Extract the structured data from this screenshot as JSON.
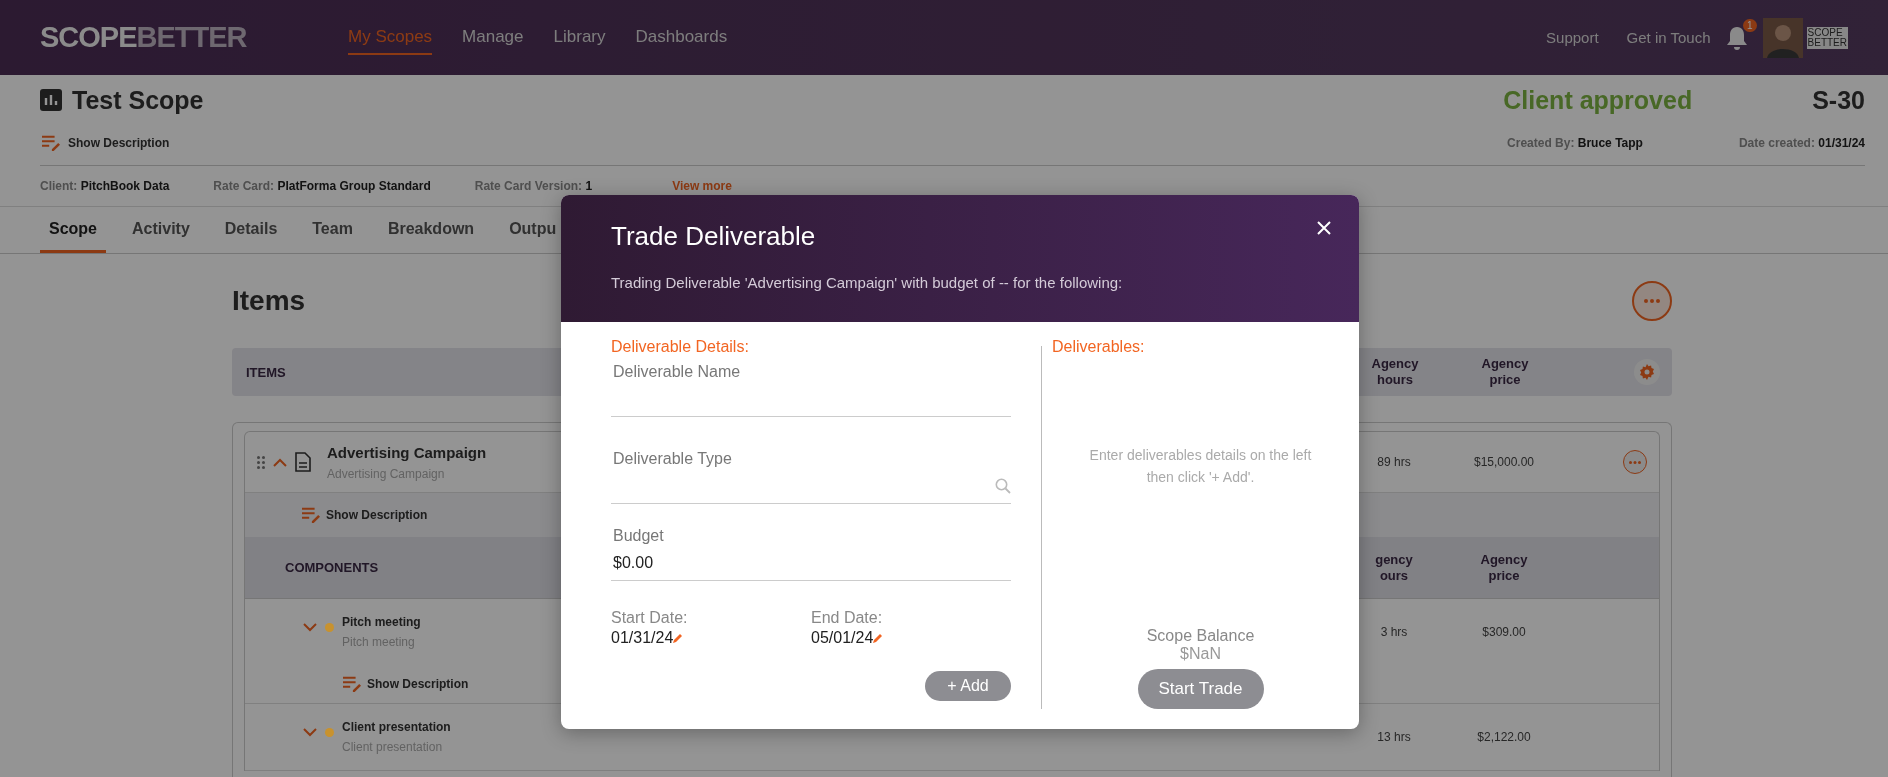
{
  "header": {
    "logo": [
      "SCOPE",
      "BETTER"
    ],
    "nav": [
      {
        "label": "My Scopes",
        "selected": true
      },
      {
        "label": "Manage",
        "selected": false
      },
      {
        "label": "Library",
        "selected": false
      },
      {
        "label": "Dashboards",
        "selected": false
      }
    ],
    "links": [
      "Support",
      "Get in Touch"
    ],
    "notification_count": "1",
    "company_logo": [
      "SCOPE",
      "BETTER"
    ]
  },
  "scope": {
    "title": "Test Scope",
    "show_description": "Show Description",
    "status": "Client approved",
    "id": "S-30",
    "created_by": {
      "label": "Created By:",
      "value": "Bruce Tapp"
    },
    "date_created": {
      "label": "Date created:",
      "value": "01/31/24"
    },
    "meta": [
      {
        "label": "Client:",
        "value": "PitchBook Data"
      },
      {
        "label": "Rate Card:",
        "value": "PlatForma Group Standard"
      },
      {
        "label": "Rate Card Version:",
        "value": "1"
      }
    ],
    "view_more": "View more"
  },
  "tabs": [
    {
      "label": "Scope",
      "selected": true
    },
    {
      "label": "Activity",
      "selected": false
    },
    {
      "label": "Details",
      "selected": false
    },
    {
      "label": "Team",
      "selected": false
    },
    {
      "label": "Breakdown",
      "selected": false
    },
    {
      "label": "Outpu",
      "selected": false
    }
  ],
  "items_section": {
    "title": "Items",
    "header": {
      "label": "ITEMS",
      "columns": [
        "Agency hours",
        "Agency price"
      ]
    },
    "items": [
      {
        "name": "Advertising Campaign",
        "subtitle": "Advertising Campaign",
        "expanded": true,
        "hours": "89 hrs",
        "price": "$15,000.00",
        "show_description": "Show Description",
        "components_header": {
          "label": "COMPONENTS",
          "columns": [
            "gency ours",
            "Agency price"
          ]
        },
        "components": [
          {
            "name": "Pitch meeting",
            "subtitle": "Pitch meeting",
            "color": "#c8922e",
            "expanded": false,
            "hours": "3 hrs",
            "price": "$309.00",
            "show_description": "Show Description"
          },
          {
            "name": "Client presentation",
            "subtitle": "Client presentation",
            "color": "#c8922e",
            "expanded": false,
            "hours": "13 hrs",
            "price": "$2,122.00"
          }
        ]
      }
    ]
  },
  "modal": {
    "title": "Trade Deliverable",
    "subtitle": "Trading Deliverable 'Advertising Campaign' with budget of -- for the following:",
    "details_heading": "Deliverable Details:",
    "name_field": {
      "label": "Deliverable Name"
    },
    "type_field": {
      "label": "Deliverable Type"
    },
    "budget_field": {
      "label": "Budget",
      "value": "$0.00"
    },
    "start_date": {
      "label": "Start Date:",
      "value": "01/31/24"
    },
    "end_date": {
      "label": "End Date:",
      "value": "05/01/24"
    },
    "add_button": "+ Add",
    "deliverables_heading": "Deliverables:",
    "empty_text": "Enter deliverables details on the left then click '+ Add'.",
    "balance_label": "Scope Balance",
    "balance_value": "$NaN",
    "start_button": "Start Trade"
  }
}
